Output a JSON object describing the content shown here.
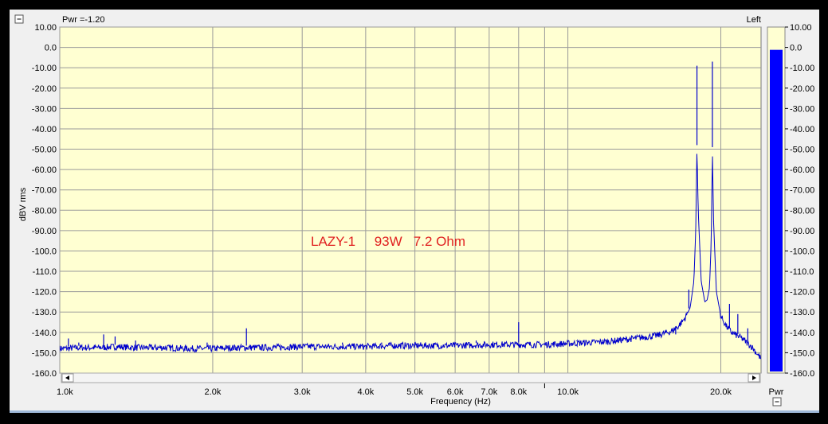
{
  "header": {
    "readout_text": "Pwr =-1.20",
    "channel_label": "Left"
  },
  "meter": {
    "label": "Pwr",
    "value_dbv": -1.2,
    "color": "#0000ff"
  },
  "colors": {
    "plot_background": "#ffffd2",
    "trace": "#0000cc",
    "grid": "#9a9a9a",
    "annotation": "#e02020"
  },
  "chart_data": {
    "type": "line",
    "title": "",
    "xlabel": "Frequency (Hz)",
    "ylabel": "dBV rms",
    "x_scale": "log",
    "xlim": [
      1000,
      24000
    ],
    "ylim": [
      -160,
      10
    ],
    "grid": true,
    "x_ticks": [
      {
        "value": 1000,
        "label": "1.0k"
      },
      {
        "value": 2000,
        "label": "2.0k"
      },
      {
        "value": 3000,
        "label": "3.0k"
      },
      {
        "value": 4000,
        "label": "4.0k"
      },
      {
        "value": 5000,
        "label": "5.0k"
      },
      {
        "value": 6000,
        "label": "6.0k"
      },
      {
        "value": 7000,
        "label": "7.0k"
      },
      {
        "value": 8000,
        "label": "8.0k"
      },
      {
        "value": 10000,
        "label": "10.0k"
      },
      {
        "value": 20000,
        "label": "20.0k"
      }
    ],
    "x_minor_ticks": [
      9000
    ],
    "y_ticks": [
      {
        "value": 10,
        "label": "10.00"
      },
      {
        "value": 0,
        "label": "0.0"
      },
      {
        "value": -10,
        "label": "-10.00"
      },
      {
        "value": -20,
        "label": "-20.00"
      },
      {
        "value": -30,
        "label": "-30.00"
      },
      {
        "value": -40,
        "label": "-40.00"
      },
      {
        "value": -50,
        "label": "-50.00"
      },
      {
        "value": -60,
        "label": "-60.00"
      },
      {
        "value": -70,
        "label": "-70.00"
      },
      {
        "value": -80,
        "label": "-80.00"
      },
      {
        "value": -90,
        "label": "-90.00"
      },
      {
        "value": -100,
        "label": "-100.0"
      },
      {
        "value": -110,
        "label": "-110.0"
      },
      {
        "value": -120,
        "label": "-120.0"
      },
      {
        "value": -130,
        "label": "-130.0"
      },
      {
        "value": -140,
        "label": "-140.0"
      },
      {
        "value": -150,
        "label": "-150.0"
      },
      {
        "value": -160,
        "label": "-160.0"
      }
    ],
    "meter_ticks": [
      {
        "value": 10,
        "label": "10.00"
      },
      {
        "value": 0,
        "label": "0.0"
      },
      {
        "value": -10,
        "label": "-10.00"
      },
      {
        "value": -20,
        "label": "-20.00"
      },
      {
        "value": -30,
        "label": "-30.00"
      },
      {
        "value": -40,
        "label": "-40.00"
      },
      {
        "value": -50,
        "label": "-50.00"
      },
      {
        "value": -60,
        "label": "-60.00"
      },
      {
        "value": -70,
        "label": "-70.00"
      },
      {
        "value": -80,
        "label": "-80.00"
      },
      {
        "value": -90,
        "label": "-90.00"
      },
      {
        "value": -100,
        "label": "-100.0"
      },
      {
        "value": -110,
        "label": "-110.0"
      },
      {
        "value": -120,
        "label": "-120.0"
      },
      {
        "value": -130,
        "label": "-130.0"
      },
      {
        "value": -140,
        "label": "-140.0"
      },
      {
        "value": -150,
        "label": "-150.0"
      },
      {
        "value": -160,
        "label": "-160.0"
      }
    ],
    "annotation": "LAZY-1     93W   7.2 Ohm",
    "series": [
      {
        "values": [
          [
            1000,
            -148
          ],
          [
            1100,
            -147.5
          ],
          [
            1200,
            -147.5
          ],
          [
            1300,
            -147
          ],
          [
            1400,
            -147.5
          ],
          [
            1500,
            -147.5
          ],
          [
            1600,
            -147.5
          ],
          [
            1800,
            -148
          ],
          [
            2000,
            -148
          ],
          [
            2200,
            -147.5
          ],
          [
            2500,
            -147.5
          ],
          [
            3000,
            -147
          ],
          [
            3500,
            -147
          ],
          [
            4000,
            -147
          ],
          [
            4500,
            -146.5
          ],
          [
            5000,
            -146.5
          ],
          [
            6000,
            -146.5
          ],
          [
            7000,
            -146
          ],
          [
            8000,
            -146
          ],
          [
            9000,
            -146
          ],
          [
            10000,
            -145.5
          ],
          [
            11000,
            -145
          ],
          [
            12000,
            -144.5
          ],
          [
            13000,
            -143.5
          ],
          [
            14000,
            -142.5
          ],
          [
            15000,
            -141.5
          ],
          [
            16000,
            -139.5
          ],
          [
            16500,
            -137
          ],
          [
            17000,
            -133
          ],
          [
            17400,
            -128
          ],
          [
            17700,
            -115
          ],
          [
            17850,
            -90
          ],
          [
            17950,
            -49
          ],
          [
            18050,
            -80
          ],
          [
            18300,
            -115
          ],
          [
            18600,
            -125
          ],
          [
            18800,
            -124
          ],
          [
            19000,
            -118
          ],
          [
            19150,
            -95
          ],
          [
            19250,
            -50
          ],
          [
            19350,
            -85
          ],
          [
            19600,
            -120
          ],
          [
            20000,
            -132
          ],
          [
            20500,
            -137
          ],
          [
            21000,
            -140
          ],
          [
            22000,
            -143
          ],
          [
            23000,
            -147
          ],
          [
            24000,
            -153
          ]
        ]
      }
    ],
    "spurs": [
      {
        "x": 1040,
        "y": -143
      },
      {
        "x": 1090,
        "y": -145
      },
      {
        "x": 1220,
        "y": -141
      },
      {
        "x": 1285,
        "y": -142
      },
      {
        "x": 1410,
        "y": -144
      },
      {
        "x": 1950,
        "y": -145
      },
      {
        "x": 2330,
        "y": -138
      },
      {
        "x": 3600,
        "y": -145
      },
      {
        "x": 4300,
        "y": -145
      },
      {
        "x": 6600,
        "y": -144
      },
      {
        "x": 8000,
        "y": -135
      },
      {
        "x": 10400,
        "y": -144
      },
      {
        "x": 16300,
        "y": -141
      },
      {
        "x": 16600,
        "y": -137
      },
      {
        "x": 17300,
        "y": -119
      },
      {
        "x": 17950,
        "y": -9
      },
      {
        "x": 19250,
        "y": -7
      },
      {
        "x": 20800,
        "y": -126
      },
      {
        "x": 21600,
        "y": -131
      },
      {
        "x": 22600,
        "y": -138
      }
    ]
  }
}
